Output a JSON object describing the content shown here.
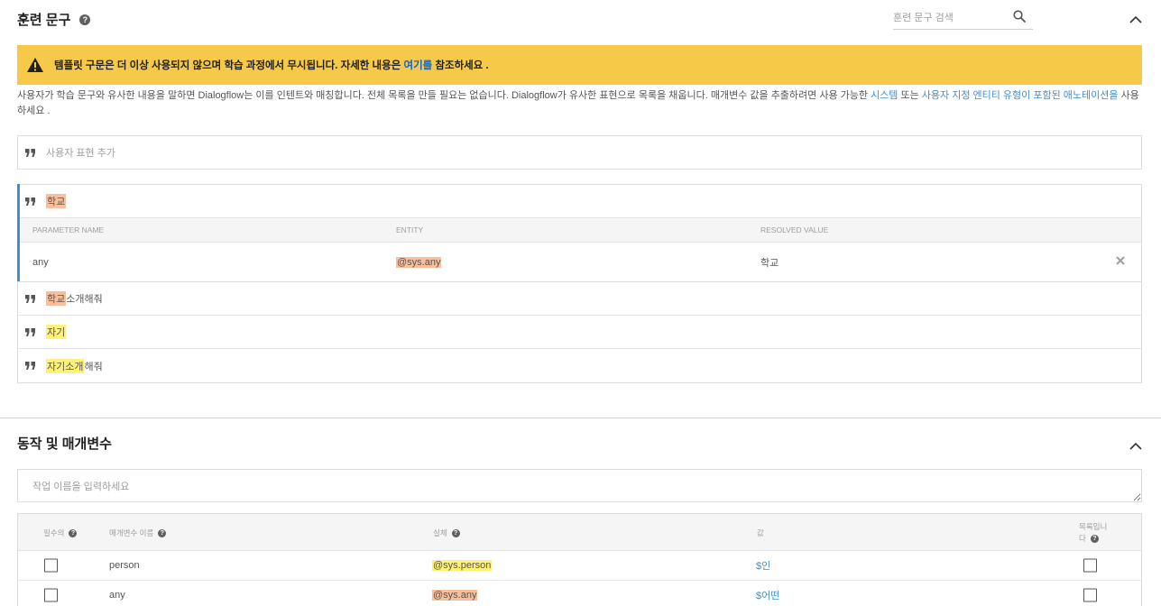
{
  "training": {
    "title": "훈련 문구",
    "help": "?",
    "search_placeholder": "훈련 문구 검색",
    "warning": {
      "text_before": "템플릿 구문은 더 이상 사용되지 않으며 학습 과정에서 무시됩니다. 자세한 내용은 ",
      "link": "여기를",
      "text_after": " 참조하세요 ."
    },
    "description": {
      "part1": "사용자가 학습 문구와 유사한 내용을 말하면 Dialogflow는 이를 인텐트와 매칭합니다. 전체 목록을 만들 필요는 없습니다. Dialogflow가 유사한 표현으로 목록을 채웁니다. 매개변수 값을 추출하려면 사용 가능한 ",
      "link1": "시스템",
      "part2": " 또는 ",
      "link2": "사용자 지정 엔티티 유형이 포함된 애노테이션을",
      "part3": " 사용하세요 ."
    },
    "add_placeholder": "사용자 표현 추가",
    "phrases": [
      {
        "hl": "학교",
        "rest": ""
      },
      {
        "hl": "학교",
        "rest": " 소개해줘"
      },
      {
        "hl": "자기",
        "rest": ""
      },
      {
        "hl": "자기소개",
        "rest": " 해줘"
      }
    ],
    "param_table": {
      "headers": [
        "PARAMETER NAME",
        "ENTITY",
        "RESOLVED VALUE"
      ],
      "row": {
        "name": "any",
        "entity": "@sys.any",
        "value": "학교"
      }
    }
  },
  "actions": {
    "title": "동작 및 매개변수",
    "input_placeholder": "작업 이름을 입력하세요",
    "headers": {
      "required": "필수의",
      "param_name": "매개변수 이름",
      "entity": "실체",
      "value": "값",
      "is_list_1": "목록입니",
      "is_list_2": "다"
    },
    "rows": [
      {
        "name": "person",
        "entity": "@sys.person",
        "value": "$인"
      },
      {
        "name": "any",
        "entity": "@sys.any",
        "value": "$어떤"
      }
    ]
  },
  "colors": {
    "warning": "#f7c948",
    "link": "#3d8fd1",
    "highlight_orange": "#f9bf9b",
    "highlight_yellow": "#fff176"
  }
}
